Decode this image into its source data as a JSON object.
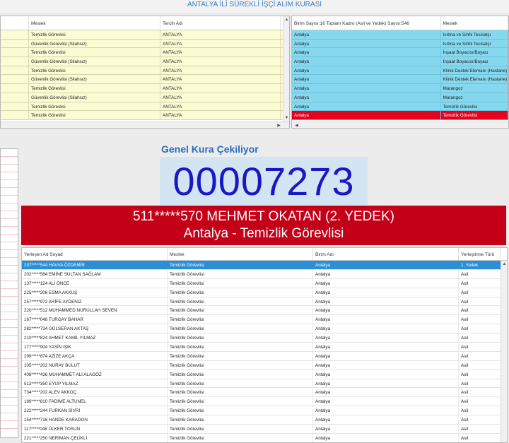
{
  "app_title": "ANTALYA İLİ SÜREKLİ İŞÇİ ALIM KURASI",
  "top_left": {
    "headers": [
      "Meslek",
      "Tercih Adı"
    ],
    "rows": [
      [
        "Temizlik Görevlisi",
        "ANTALYA"
      ],
      [
        "Güvenlik Görevlisi (Silahsız)",
        "ANTALYA"
      ],
      [
        "Temizlik Görevlisi",
        "ANTALYA"
      ],
      [
        "Güvenlik Görevlisi (Silahsız)",
        "ANTALYA"
      ],
      [
        "Temizlik Görevlisi",
        "ANTALYA"
      ],
      [
        "Güvenlik Görevlisi (Silahsız)",
        "ANTALYA"
      ],
      [
        "Temizlik Görevlisi",
        "ANTALYA"
      ],
      [
        "Güvenlik Görevlisi (Silahsız)",
        "ANTALYA"
      ],
      [
        "Temizlik Görevlisi",
        "ANTALYA"
      ],
      [
        "Temizlik Görevlisi",
        "ANTALYA"
      ]
    ]
  },
  "top_right": {
    "headers": [
      "Birim Sayısı:16 Toplam Kadro (Asil ve Yedek) Sayısı:546",
      "Meslek"
    ],
    "rows": [
      [
        "Antalya",
        "Isıtma ve Sıhhi Tesisatçı"
      ],
      [
        "Antalya",
        "Isıtma ve Sıhhi Tesisatçı"
      ],
      [
        "Antalya",
        "İnşaat Boyacısı/Boyacı"
      ],
      [
        "Antalya",
        "İnşaat Boyacısı/Boyacı"
      ],
      [
        "Antalya",
        "Klinik Destek Elemanı (Hastane)"
      ],
      [
        "Antalya",
        "Klinik Destek Elemanı (Hastane)"
      ],
      [
        "Antalya",
        "Marangoz"
      ],
      [
        "Antalya",
        "Marangoz"
      ],
      [
        "Antalya",
        "Temizlik Görevlisi"
      ],
      [
        "Antalya",
        "Temizlik Görevlisi"
      ]
    ]
  },
  "draw": {
    "heading": "Genel Kura Çekiliyor",
    "number": "00007273",
    "winner_line1": "511*****570 MEHMET OKATAN (2. YEDEK)",
    "winner_line2": "Antalya - Temizlik Görevlisi"
  },
  "results": {
    "headers": [
      "Yerleşen Ad Soyad",
      "Meslek",
      "Birim Adı",
      "Yerleştirme Türü"
    ],
    "rows": [
      [
        "237*****544 HAVVA ÖZDEMİR",
        "Temizlik Görevlisi",
        "Antalya",
        "1. Yedek"
      ],
      [
        "202*****564 EMİNE SULTAN SAĞLAM",
        "Temizlik Görevlisi",
        "Antalya",
        "Asil"
      ],
      [
        "137*****124 ALİ ÖNCE",
        "Temizlik Görevlisi",
        "Antalya",
        "Asil"
      ],
      [
        "225*****208 ESMA AKKUŞ",
        "Temizlik Görevlisi",
        "Antalya",
        "Asil"
      ],
      [
        "257*****972 ARİFE AYDENİZ",
        "Temizlik Görevlisi",
        "Antalya",
        "Asil"
      ],
      [
        "220*****512 MUHAMMED NURULLAH SEVEN",
        "Temizlik Görevlisi",
        "Antalya",
        "Asil"
      ],
      [
        "167*****048 TURGAY BAHAR",
        "Temizlik Görevlisi",
        "Antalya",
        "Asil"
      ],
      [
        "282*****734 GÜLSERAN AKTAŞ",
        "Temizlik Görevlisi",
        "Antalya",
        "Asil"
      ],
      [
        "210*****824 AHMET KAMİL YILMAZ",
        "Temizlik Görevlisi",
        "Antalya",
        "Asil"
      ],
      [
        "177*****904 YASİN IŞIK",
        "Temizlik Görevlisi",
        "Antalya",
        "Asil"
      ],
      [
        "299*****874 AZİZE AKÇA",
        "Temizlik Görevlisi",
        "Antalya",
        "Asil"
      ],
      [
        "105*****202 NURAY BULUT",
        "Temizlik Görevlisi",
        "Antalya",
        "Asil"
      ],
      [
        "408*****436 MUHAMMET ALİ ALAGÖZ",
        "Temizlik Görevlisi",
        "Antalya",
        "Asil"
      ],
      [
        "513*****350 EYÜP YILMAZ",
        "Temizlik Görevlisi",
        "Antalya",
        "Asil"
      ],
      [
        "734*****202 ALEV AKKOÇ",
        "Temizlik Görevlisi",
        "Antalya",
        "Asil"
      ],
      [
        "189*****810 FADİME ALTUNEL",
        "Temizlik Görevlisi",
        "Antalya",
        "Asil"
      ],
      [
        "222*****244 FURKAN SİVRİ",
        "Temizlik Görevlisi",
        "Antalya",
        "Asil"
      ],
      [
        "154*****716 HANDE KARADON",
        "Temizlik Görevlisi",
        "Antalya",
        "Asil"
      ],
      [
        "117*****048 ÜLKER TOSUN",
        "Temizlik Görevlisi",
        "Antalya",
        "Asil"
      ],
      [
        "221*****250 NERİMAN ÇELİKLİ",
        "Temizlik Görevlisi",
        "Antalya",
        "Asil"
      ]
    ]
  }
}
